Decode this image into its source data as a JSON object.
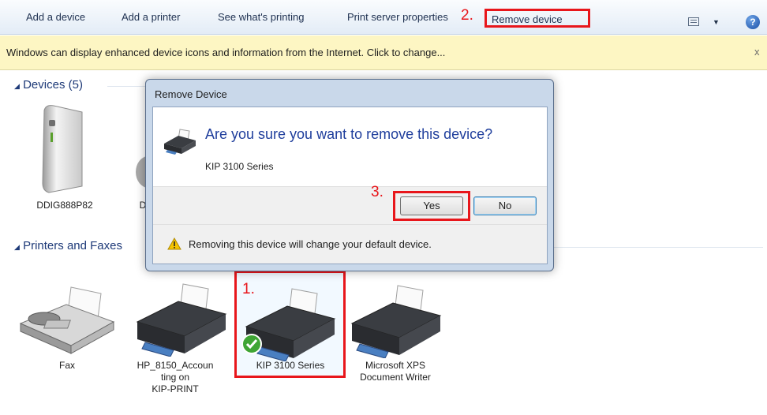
{
  "toolbar": {
    "add_device": "Add a device",
    "add_printer": "Add a printer",
    "see_printing": "See what's printing",
    "print_server": "Print server properties",
    "remove_device": "Remove device"
  },
  "infobar": {
    "text": "Windows can display enhanced device icons and information from the Internet. Click to change...",
    "close": "x"
  },
  "groups": {
    "devices": "Devices (5)",
    "printers": "Printers and Faxes"
  },
  "devices": {
    "items": [
      {
        "label": "DDIG888P82",
        "icon": "desktop-tower-icon"
      },
      {
        "label": "D",
        "icon": "device-icon"
      }
    ]
  },
  "printers": {
    "items": [
      {
        "label": "Fax",
        "icon": "fax-icon"
      },
      {
        "label_lines": [
          "HP_8150_Accoun",
          "ting on",
          "KIP-PRINT"
        ],
        "icon": "printer-icon"
      },
      {
        "label": "KIP 3100 Series",
        "icon": "printer-icon",
        "default": true
      },
      {
        "label_lines": [
          "Microsoft XPS",
          "Document Writer"
        ],
        "icon": "printer-icon"
      }
    ]
  },
  "dialog": {
    "title": "Remove Device",
    "heading": "Are you sure you want to remove this device?",
    "device_name": "KIP 3100 Series",
    "yes": "Yes",
    "no": "No",
    "warning": "Removing this device will change your default device."
  },
  "annotations": {
    "step1": "1.",
    "step2": "2.",
    "step3": "3."
  },
  "colors": {
    "annotation_red": "#e8161b",
    "heading_blue": "#1f3e9c",
    "infobar_yellow": "#fdf6c3"
  }
}
